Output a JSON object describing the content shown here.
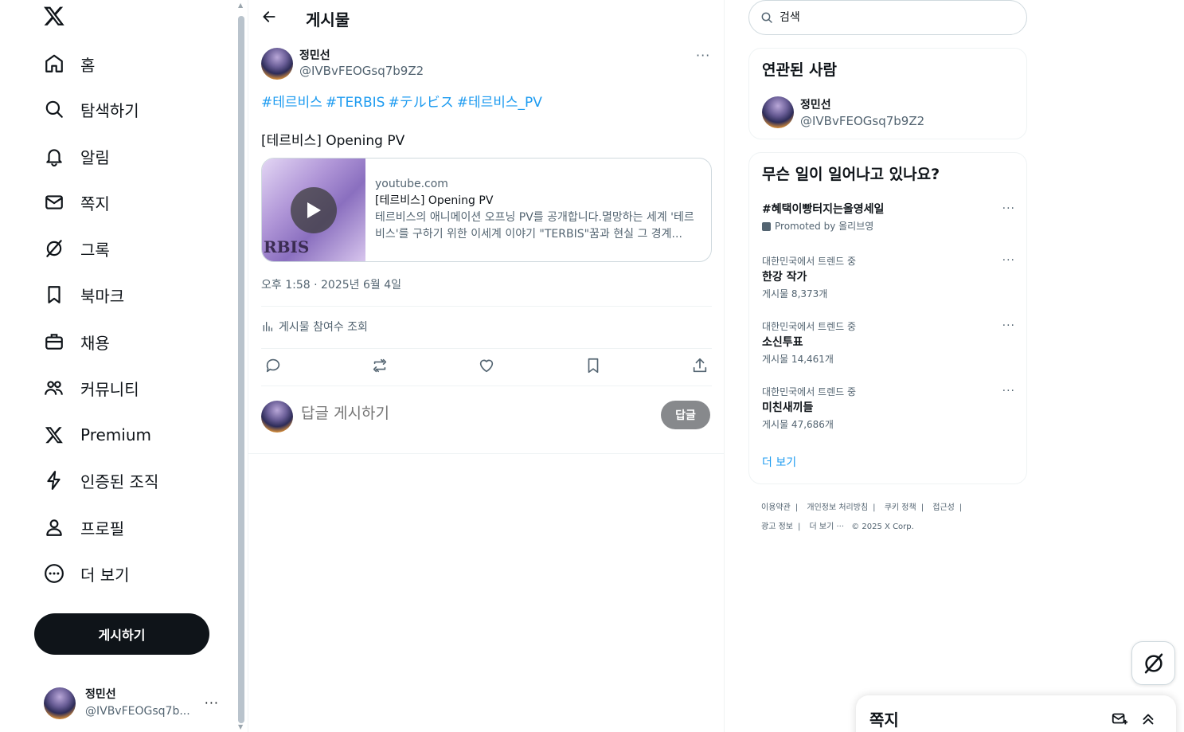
{
  "nav": {
    "items": [
      {
        "label": "홈",
        "icon": "home-icon"
      },
      {
        "label": "탐색하기",
        "icon": "search-icon"
      },
      {
        "label": "알림",
        "icon": "bell-icon"
      },
      {
        "label": "쪽지",
        "icon": "mail-icon"
      },
      {
        "label": "그록",
        "icon": "grok-icon"
      },
      {
        "label": "북마크",
        "icon": "bookmark-icon"
      },
      {
        "label": "채용",
        "icon": "briefcase-icon"
      },
      {
        "label": "커뮤니티",
        "icon": "people-icon"
      },
      {
        "label": "Premium",
        "icon": "x-logo-icon"
      },
      {
        "label": "인증된 조직",
        "icon": "lightning-icon"
      },
      {
        "label": "프로필",
        "icon": "person-icon"
      },
      {
        "label": "더 보기",
        "icon": "more-circle-icon"
      }
    ],
    "post_button": "게시하기",
    "account": {
      "name": "정민선",
      "handle": "@IVBvFEOGsq7b...",
      "more": "···"
    }
  },
  "main": {
    "title": "게시물",
    "post": {
      "author_name": "정민선",
      "author_handle": "@IVBvFEOGsq7b9Z2",
      "more": "···",
      "hashtags": [
        "#테르비스",
        "#TERBIS",
        "#テルビス",
        "#테르비스_PV"
      ],
      "text": "[테르비스] Opening PV",
      "card": {
        "domain": "youtube.com",
        "title": "[테르비스] Opening PV",
        "description": "테르비스의 애니메이션 오프닝 PV를 공개합니다.멸망하는 세계 '테르비스'를 구하기 위한 이세계 이야기 \"TERBIS\"꿈과 현실 그 경계...",
        "thumb_text": "RBIS"
      },
      "timestamp": "오후 1:58 · 2025년 6월 4일",
      "engagement_label": "게시물 참여수 조회"
    },
    "reply": {
      "placeholder": "답글 게시하기",
      "button": "답글"
    }
  },
  "right": {
    "search_placeholder": "검색",
    "related": {
      "title": "연관된 사람",
      "name": "정민선",
      "handle": "@IVBvFEOGsq7b9Z2"
    },
    "trends": {
      "title": "무슨 일이 일어나고 있나요?",
      "promoted": {
        "name": "#혜택이빵터지는올영세일",
        "promo": "Promoted by 올리브영"
      },
      "items": [
        {
          "context": "대한민국에서 트렌드 중",
          "name": "한강 작가",
          "count": "게시물 8,373개"
        },
        {
          "context": "대한민국에서 트렌드 중",
          "name": "소신투표",
          "count": "게시물 14,461개"
        },
        {
          "context": "대한민국에서 트렌드 중",
          "name": "미친새끼들",
          "count": "게시물 47,686개"
        }
      ],
      "more_dots": "···",
      "show_more": "더 보기"
    },
    "footer": {
      "links": [
        "이용약관",
        "개인정보 처리방침",
        "쿠키 정책",
        "접근성",
        "광고 정보",
        "더 보기 ···"
      ],
      "copyright": "© 2025 X Corp."
    }
  },
  "dm_drawer": {
    "title": "쪽지"
  },
  "colors": {
    "accent": "#1d9bf0",
    "text": "#0f1419",
    "muted": "#536471",
    "border": "#eff3f4"
  }
}
